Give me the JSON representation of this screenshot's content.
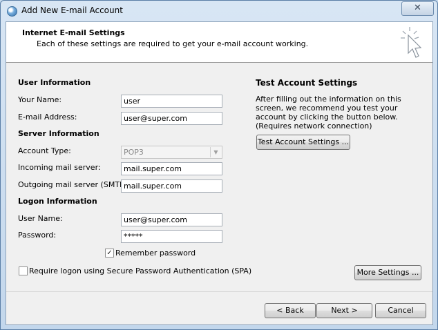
{
  "window": {
    "title": "Add New E-mail Account",
    "close_label": "✕"
  },
  "header": {
    "title": "Internet E-mail Settings",
    "description": "Each of these settings are required to get your e-mail account working."
  },
  "user_info": {
    "heading": "User Information",
    "name_label": "Your Name:",
    "name_value": "user",
    "email_label": "E-mail Address:",
    "email_value": "user@super.com"
  },
  "server_info": {
    "heading": "Server Information",
    "account_type_label": "Account Type:",
    "account_type_value": "POP3",
    "incoming_label": "Incoming mail server:",
    "incoming_value": "mail.super.com",
    "outgoing_label": "Outgoing mail server (SMTP):",
    "outgoing_value": "mail.super.com"
  },
  "logon_info": {
    "heading": "Logon Information",
    "username_label": "User Name:",
    "username_value": "user@super.com",
    "password_label": "Password:",
    "password_value": "*****",
    "remember_label": "Remember password",
    "remember_checked": true,
    "spa_label": "Require logon using Secure Password Authentication (SPA)",
    "spa_checked": false
  },
  "test": {
    "heading": "Test Account Settings",
    "description": "After filling out the information on this screen, we recommend you test your account by clicking the button below. (Requires network connection)",
    "button": "Test Account Settings ..."
  },
  "buttons": {
    "more_settings": "More Settings ...",
    "back": "< Back",
    "next": "Next >",
    "cancel": "Cancel"
  }
}
